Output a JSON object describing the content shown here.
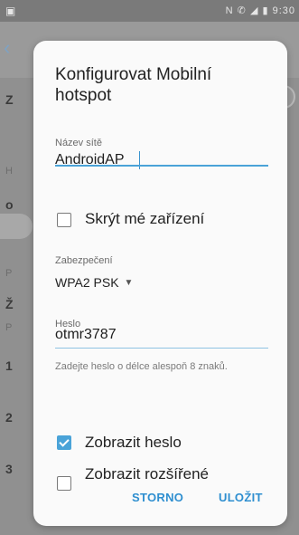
{
  "status_bar": {
    "time": "9:30",
    "signal_icons": "N ✆ ◢ ▮"
  },
  "dialog": {
    "title": "Konfigurovat Mobilní hotspot",
    "network_name": {
      "label": "Název sítě",
      "value": "AndroidAP"
    },
    "hide_device": {
      "label": "Skrýt mé zařízení",
      "checked": false
    },
    "security": {
      "label": "Zabezpečení",
      "value": "WPA2 PSK"
    },
    "password": {
      "label": "Heslo",
      "value": "otmr3787",
      "hint": "Zadejte heslo o délce alespoň 8 znaků."
    },
    "show_password": {
      "label": "Zobrazit heslo",
      "checked": true
    },
    "show_advanced": {
      "label": "Zobrazit rozšířené",
      "checked": false
    },
    "buttons": {
      "cancel": "STORNO",
      "save": "ULOŽIT"
    }
  },
  "background": {
    "rows": [
      "Z",
      "H",
      "o",
      "P",
      "Ž",
      "P",
      "1",
      "2",
      "3"
    ]
  },
  "colors": {
    "accent": "#4aa3d8",
    "button_text": "#2f8fd0"
  }
}
